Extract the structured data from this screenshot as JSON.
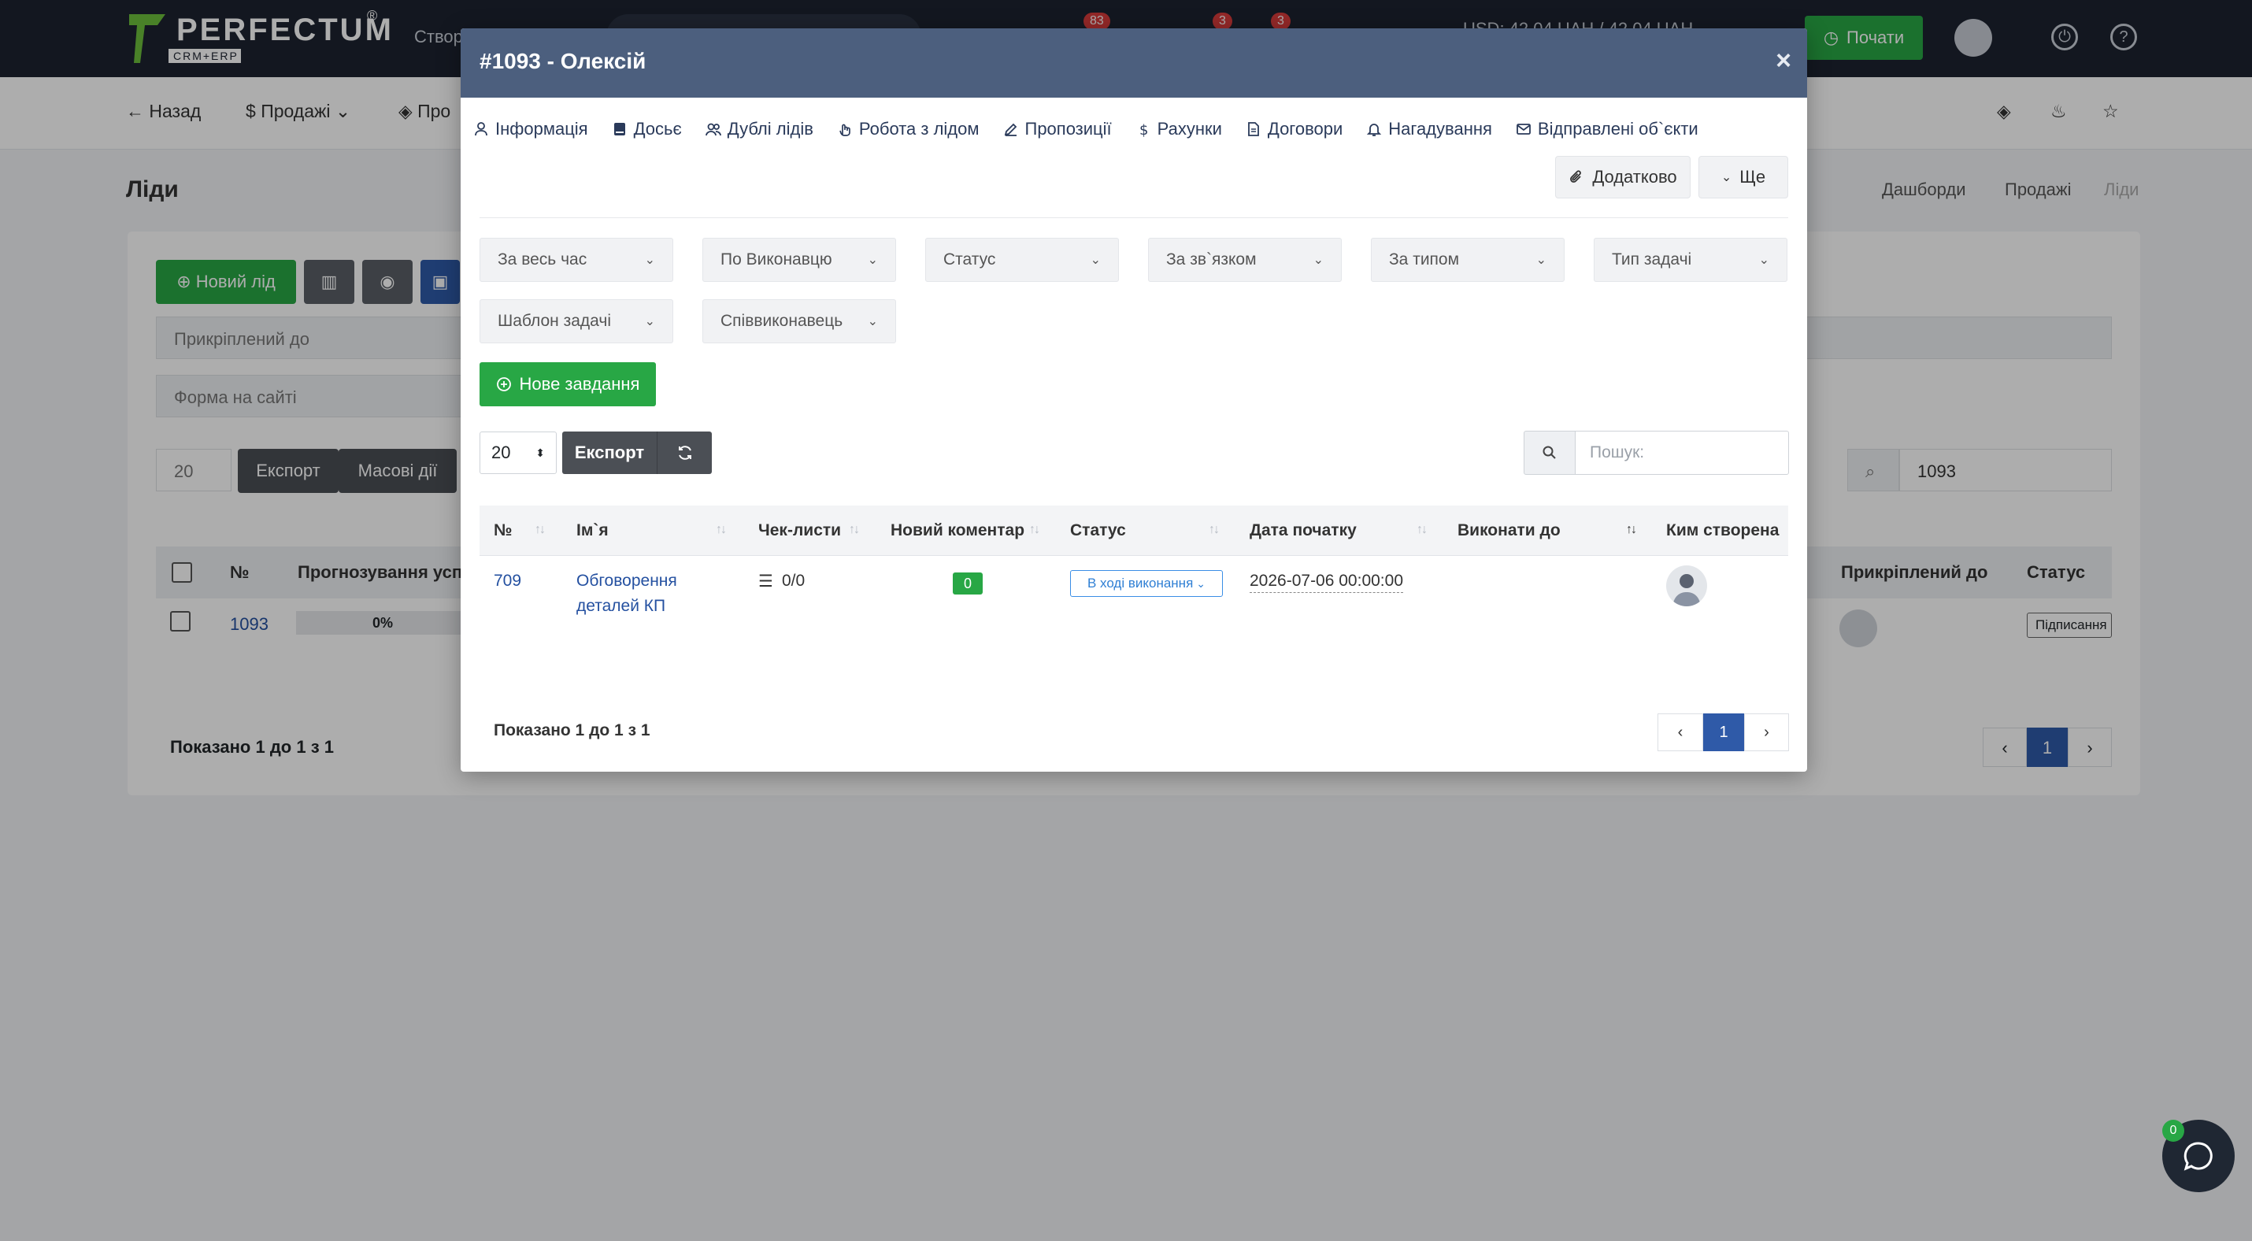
{
  "topbar": {
    "brand": "PERFECTUM",
    "brand_sub": "CRM+ERP",
    "brand_mark": "®",
    "create_label": "Створ",
    "notif_badges": [
      "83",
      "3",
      "3"
    ],
    "currency_rate": "USD: 42.04 UAH / 42.04 UAH",
    "start_label": "Почати"
  },
  "subbar": {
    "back": "Назад",
    "sales": "Продажі",
    "pro": "Про"
  },
  "page": {
    "title": "Ліди",
    "breadcrumbs": [
      "Дашборди",
      "Продажі",
      "Ліди"
    ],
    "new_lead": "Новий лід",
    "attached_to": "Прикріплений до",
    "site_form": "Форма на сайті",
    "page_len": "20",
    "export": "Експорт",
    "mass_actions": "Масові дії",
    "search_value": "1093",
    "columns": [
      "№",
      "Прогнозування успіх",
      "Прикріплений до",
      "Статус"
    ],
    "row_id": "1093",
    "row_progress": "0%",
    "row_status": "Підписання",
    "shown": "Показано 1 до 1 з 1",
    "page_num": "1"
  },
  "modal": {
    "title": "#1093 - Олексій",
    "close": "×",
    "tabs": [
      {
        "label": "Інформація",
        "icon": "user-icon"
      },
      {
        "label": "Досьє",
        "icon": "book-icon"
      },
      {
        "label": "Дублі лідів",
        "icon": "users-icon"
      },
      {
        "label": "Робота з лідом",
        "icon": "hand-icon"
      },
      {
        "label": "Пропозиції",
        "icon": "edit-icon"
      },
      {
        "label": "Рахунки",
        "icon": "dollar-icon"
      },
      {
        "label": "Договори",
        "icon": "file-icon"
      },
      {
        "label": "Нагадування",
        "icon": "bell-icon"
      },
      {
        "label": "Відправлені об`єкти",
        "icon": "mail-icon"
      }
    ],
    "extra_btn": "Додатково",
    "more_btn": "Ще",
    "filters": [
      "За весь час",
      "По Виконавцю",
      "Статус",
      "За зв`язком",
      "За типом",
      "Тип задачі",
      "Шаблон задачі",
      "Співвиконавець"
    ],
    "new_task": "Нове завдання",
    "page_len": "20",
    "export": "Експорт",
    "search_placeholder": "Пошук:",
    "columns": [
      "№",
      "Ім`я",
      "Чек-листи",
      "Новий коментар",
      "Статус",
      "Дата початку",
      "Виконати до",
      "Ким створена"
    ],
    "rows": [
      {
        "id": "709",
        "name_line1": "Обговорення",
        "name_line2": "деталей КП",
        "checklist": "0/0",
        "new_comments": "0",
        "status": "В ході виконання",
        "start_date": "2026-07-06 00:00:00",
        "due": ""
      }
    ],
    "shown": "Показано 1 до 1 з 1",
    "page_num": "1"
  },
  "chat": {
    "badge": "0"
  },
  "colors": {
    "accent_green": "#28a745",
    "modal_header": "#4c5f7e",
    "link_blue": "#2450a0",
    "page_active": "#2f5aa8"
  }
}
